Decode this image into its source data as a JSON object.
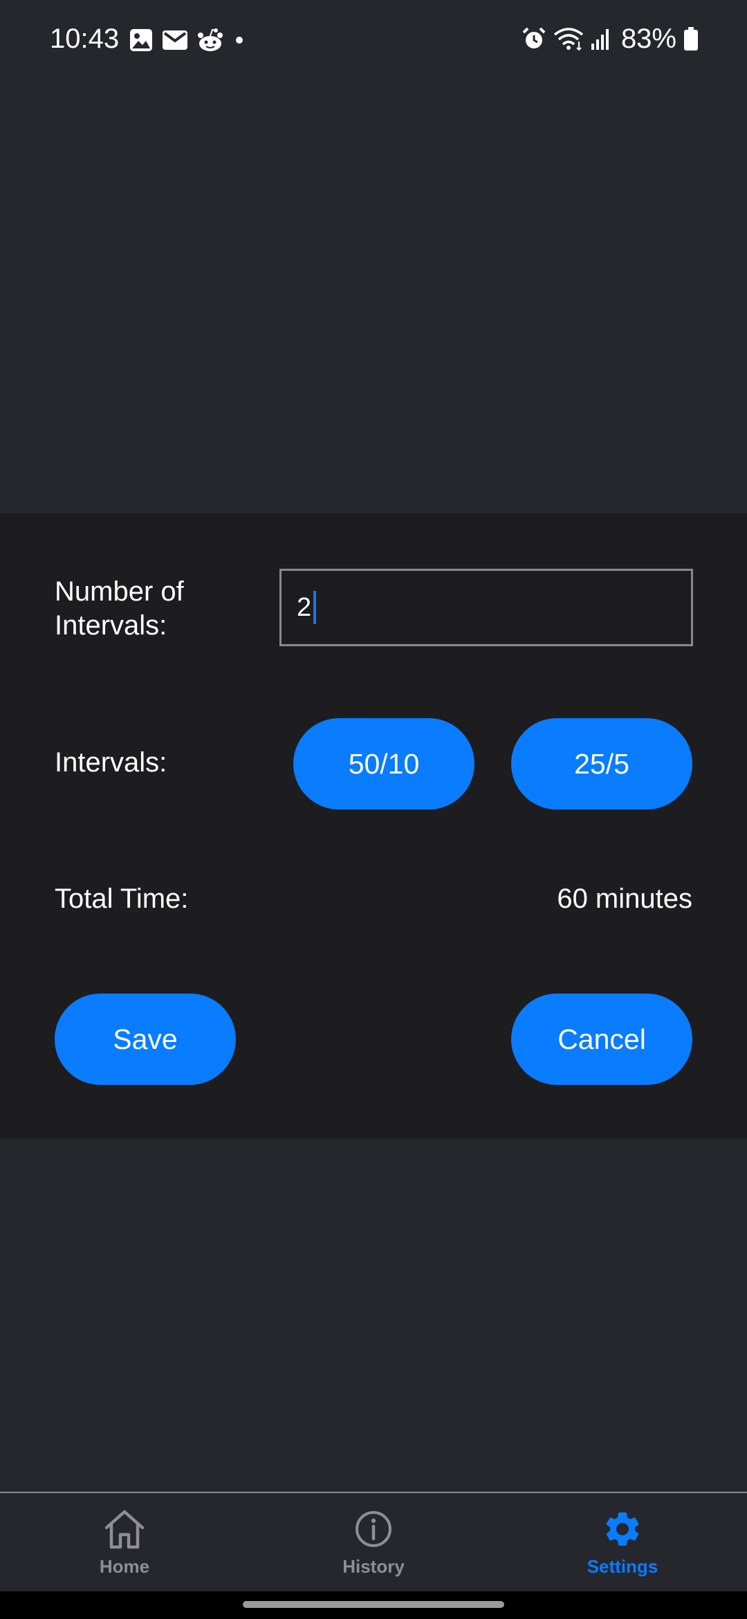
{
  "status_bar": {
    "time": "10:43",
    "battery": "83%",
    "left_icons": [
      "gallery-icon",
      "mail-icon",
      "reddit-icon",
      "dot-icon"
    ],
    "right_icons": [
      "alarm-icon",
      "wifi-icon",
      "signal-icon",
      "battery-icon"
    ]
  },
  "form": {
    "intervals_count_label": "Number of\nIntervals:",
    "intervals_count_value": "2",
    "interval_type_label": "Intervals:",
    "interval_options": [
      "50/10",
      "25/5"
    ],
    "total_label": "Total Time:",
    "total_value": "60 minutes",
    "save_label": "Save",
    "cancel_label": "Cancel"
  },
  "bottom_nav": {
    "items": [
      {
        "label": "Home",
        "icon": "home-icon",
        "active": false
      },
      {
        "label": "History",
        "icon": "info-icon",
        "active": false
      },
      {
        "label": "Settings",
        "icon": "gear-icon",
        "active": true
      }
    ]
  },
  "colors": {
    "background": "#25272d",
    "panel": "#1d1d20",
    "accent": "#0a7cff",
    "inactive_nav": "#8e8e93"
  }
}
